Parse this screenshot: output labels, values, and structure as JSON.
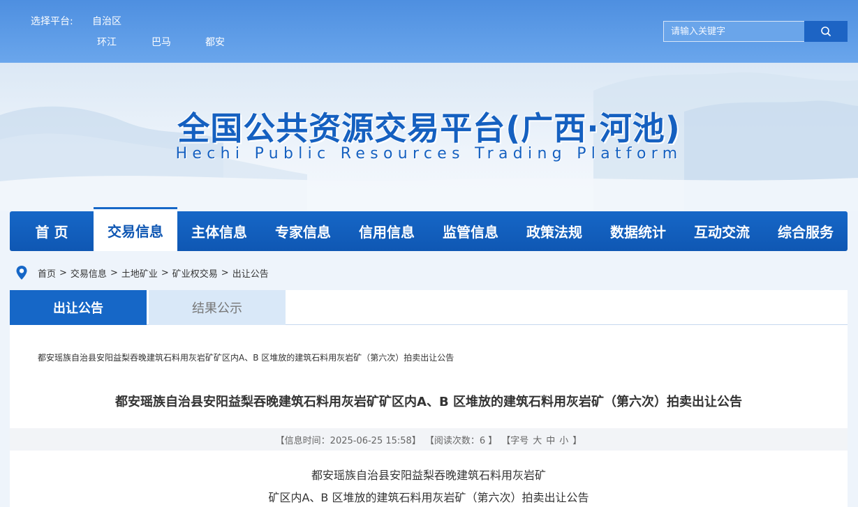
{
  "header": {
    "platform_label": "选择平台:",
    "platforms": [
      "自治区",
      "环江",
      "巴马",
      "都安"
    ],
    "search_placeholder": "请输入关键字"
  },
  "banner": {
    "title": "全国公共资源交易平台(广西·河池)",
    "subtitle": "Hechi Public Resources Trading Platform"
  },
  "nav": {
    "items": [
      "首 页",
      "交易信息",
      "主体信息",
      "专家信息",
      "信用信息",
      "监管信息",
      "政策法规",
      "数据统计",
      "互动交流",
      "综合服务"
    ],
    "active_index": 1
  },
  "breadcrumb": {
    "items": [
      "首页",
      "交易信息",
      "土地矿业",
      "矿业权交易",
      "出让公告"
    ],
    "separator": ">"
  },
  "tabs": {
    "active": "出让公告",
    "inactive": "结果公示"
  },
  "article": {
    "small_title": "都安瑶族自治县安阳益梨吞晚建筑石料用灰岩矿矿区内A、B 区堆放的建筑石料用灰岩矿（第六次）拍卖出让公告",
    "title": "都安瑶族自治县安阳益梨吞晚建筑石料用灰岩矿矿区内A、B 区堆放的建筑石料用灰岩矿（第六次）拍卖出让公告",
    "meta_time": "【信息时间：2025-06-25 15:58】",
    "meta_views": "【阅读次数：6 】",
    "meta_font_prefix": "【字号",
    "meta_font_large": "大",
    "meta_font_medium": "中",
    "meta_font_small": "小",
    "meta_font_suffix": "】",
    "body_line1": "都安瑶族自治县安阳益梨吞晚建筑石料用灰岩矿",
    "body_line2": "矿区内A、B 区堆放的建筑石料用灰岩矿（第六次）拍卖出让公告"
  },
  "colors": {
    "primary": "#1667c7",
    "topbar": "#5a9ae6",
    "title_blue": "#1560c0"
  }
}
